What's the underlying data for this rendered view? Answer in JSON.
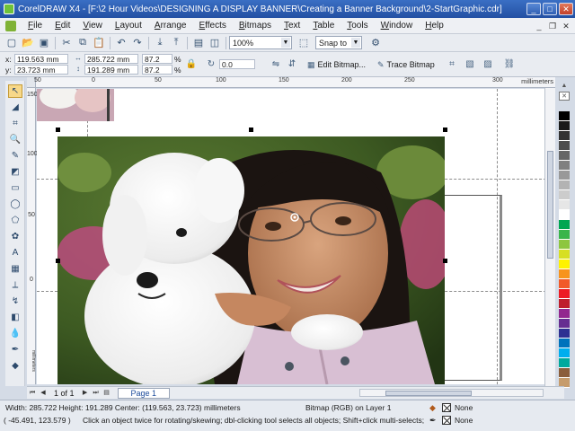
{
  "window": {
    "title": "CorelDRAW X4 - [F:\\2 Hour Videos\\DESIGNING A DISPLAY BANNER\\Creating a Banner Background\\2-StartGraphic.cdr]"
  },
  "menu": {
    "items": [
      "File",
      "Edit",
      "View",
      "Layout",
      "Arrange",
      "Effects",
      "Bitmaps",
      "Text",
      "Table",
      "Tools",
      "Window",
      "Help"
    ]
  },
  "standard_toolbar": {
    "zoom_value": "100%",
    "snap_label": "Snap to"
  },
  "property_bar": {
    "x_label": "x:",
    "x_value": "119.563 mm",
    "y_label": "y:",
    "y_value": "23.723 mm",
    "w_value": "285.722 mm",
    "h_value": "191.289 mm",
    "scale_x": "87.2",
    "scale_y": "87.2",
    "percent": "%",
    "rotation": "0.0",
    "edit_bitmap": "Edit Bitmap...",
    "trace_bitmap": "Trace Bitmap"
  },
  "rulers": {
    "unit": "millimeters",
    "h_ticks": [
      "50",
      "0",
      "50",
      "100",
      "150",
      "200",
      "250",
      "300"
    ],
    "v_ticks": [
      "150",
      "100",
      "50",
      "0"
    ],
    "v_unit": "millimeters"
  },
  "document_nav": {
    "page_count": "1 of 1",
    "page_tab": "Page 1"
  },
  "status": {
    "dimensions": "Width: 285.722  Height: 191.289  Center: (119.563, 23.723)  millimeters",
    "object_info": "Bitmap (RGB) on Layer 1",
    "cursor_pos": "( -45.491, 123.579 )",
    "hint": "Click an object twice for rotating/skewing; dbl-clicking tool selects all objects; Shift+click multi-selects; Alt+click...",
    "fill_label": "None",
    "outline_label": "None"
  },
  "palette": {
    "colors": [
      "#000000",
      "#1a1a1a",
      "#333333",
      "#4d4d4d",
      "#666666",
      "#808080",
      "#999999",
      "#b3b3b3",
      "#cccccc",
      "#e6e6e6",
      "#ffffff",
      "#00a651",
      "#39b54a",
      "#8dc63f",
      "#d7df23",
      "#fff200",
      "#f7941d",
      "#f15a29",
      "#ed1c24",
      "#be1e2d",
      "#92278f",
      "#662d91",
      "#2e3192",
      "#0072bc",
      "#00aeef",
      "#00a99d",
      "#8b5e3c",
      "#c69c6d"
    ]
  }
}
